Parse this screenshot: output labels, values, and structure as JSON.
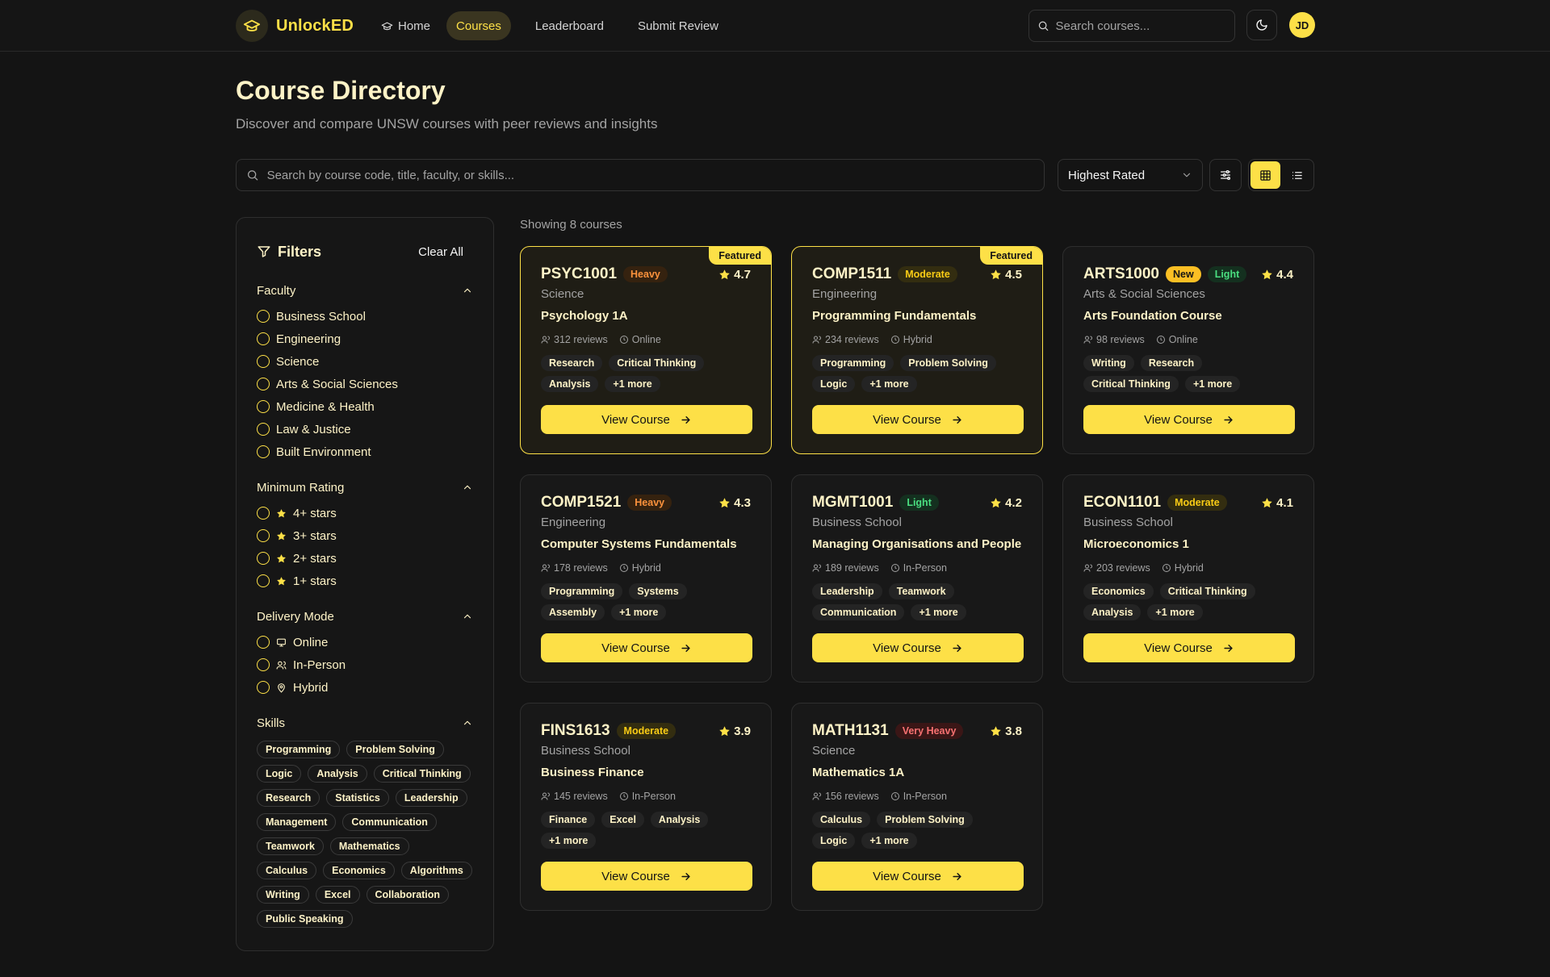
{
  "brand": {
    "name": "UnlockED"
  },
  "nav": {
    "links": [
      {
        "label": "Home"
      },
      {
        "label": "Courses"
      },
      {
        "label": "Leaderboard"
      },
      {
        "label": "Submit Review"
      }
    ],
    "search_placeholder": "Search courses...",
    "avatar_initials": "JD"
  },
  "header": {
    "title": "Course Directory",
    "subtitle": "Discover and compare UNSW courses with peer reviews and insights"
  },
  "toolbar": {
    "search_placeholder": "Search by course code, title, faculty, or skills...",
    "sort_value": "Highest Rated"
  },
  "filters": {
    "title": "Filters",
    "clear_label": "Clear All",
    "faculty": {
      "title": "Faculty",
      "options": [
        "Business School",
        "Engineering",
        "Science",
        "Arts & Social Sciences",
        "Medicine & Health",
        "Law & Justice",
        "Built Environment"
      ]
    },
    "rating": {
      "title": "Minimum Rating",
      "options": [
        "4+ stars",
        "3+ stars",
        "2+ stars",
        "1+ stars"
      ]
    },
    "delivery": {
      "title": "Delivery Mode",
      "options": [
        "Online",
        "In-Person",
        "Hybrid"
      ]
    },
    "skills": {
      "title": "Skills",
      "options": [
        "Programming",
        "Problem Solving",
        "Logic",
        "Analysis",
        "Critical Thinking",
        "Research",
        "Statistics",
        "Leadership",
        "Management",
        "Communication",
        "Teamwork",
        "Mathematics",
        "Calculus",
        "Economics",
        "Algorithms",
        "Writing",
        "Excel",
        "Collaboration",
        "Public Speaking"
      ]
    }
  },
  "results": {
    "showing": "Showing 8 courses",
    "view_label": "View Course",
    "courses": [
      {
        "code": "PSYC1001",
        "workload": "Heavy",
        "rating": "4.7",
        "faculty": "Science",
        "title": "Psychology 1A",
        "reviews": "312 reviews",
        "mode": "Online",
        "tags": [
          "Research",
          "Critical Thinking",
          "Analysis",
          "+1 more"
        ],
        "featured": "Featured",
        "new": ""
      },
      {
        "code": "COMP1511",
        "workload": "Moderate",
        "rating": "4.5",
        "faculty": "Engineering",
        "title": "Programming Fundamentals",
        "reviews": "234 reviews",
        "mode": "Hybrid",
        "tags": [
          "Programming",
          "Problem Solving",
          "Logic",
          "+1 more"
        ],
        "featured": "Featured",
        "new": ""
      },
      {
        "code": "ARTS1000",
        "workload": "Light",
        "rating": "4.4",
        "faculty": "Arts & Social Sciences",
        "title": "Arts Foundation Course",
        "reviews": "98 reviews",
        "mode": "Online",
        "tags": [
          "Writing",
          "Research",
          "Critical Thinking",
          "+1 more"
        ],
        "featured": "",
        "new": "New"
      },
      {
        "code": "COMP1521",
        "workload": "Heavy",
        "rating": "4.3",
        "faculty": "Engineering",
        "title": "Computer Systems Fundamentals",
        "reviews": "178 reviews",
        "mode": "Hybrid",
        "tags": [
          "Programming",
          "Systems",
          "Assembly",
          "+1 more"
        ],
        "featured": "",
        "new": ""
      },
      {
        "code": "MGMT1001",
        "workload": "Light",
        "rating": "4.2",
        "faculty": "Business School",
        "title": "Managing Organisations and People",
        "reviews": "189 reviews",
        "mode": "In-Person",
        "tags": [
          "Leadership",
          "Teamwork",
          "Communication",
          "+1 more"
        ],
        "featured": "",
        "new": ""
      },
      {
        "code": "ECON1101",
        "workload": "Moderate",
        "rating": "4.1",
        "faculty": "Business School",
        "title": "Microeconomics 1",
        "reviews": "203 reviews",
        "mode": "Hybrid",
        "tags": [
          "Economics",
          "Critical Thinking",
          "Analysis",
          "+1 more"
        ],
        "featured": "",
        "new": ""
      },
      {
        "code": "FINS1613",
        "workload": "Moderate",
        "rating": "3.9",
        "faculty": "Business School",
        "title": "Business Finance",
        "reviews": "145 reviews",
        "mode": "In-Person",
        "tags": [
          "Finance",
          "Excel",
          "Analysis",
          "+1 more"
        ],
        "featured": "",
        "new": ""
      },
      {
        "code": "MATH1131",
        "workload": "Very Heavy",
        "rating": "3.8",
        "faculty": "Science",
        "title": "Mathematics 1A",
        "reviews": "156 reviews",
        "mode": "In-Person",
        "tags": [
          "Calculus",
          "Problem Solving",
          "Logic",
          "+1 more"
        ],
        "featured": "",
        "new": ""
      }
    ]
  },
  "colors": {
    "accent": "#fde047",
    "background": "#141414",
    "workload_light": "#4ade80",
    "workload_moderate": "#facc15",
    "workload_heavy": "#fb923c",
    "workload_very_heavy": "#f87171"
  }
}
